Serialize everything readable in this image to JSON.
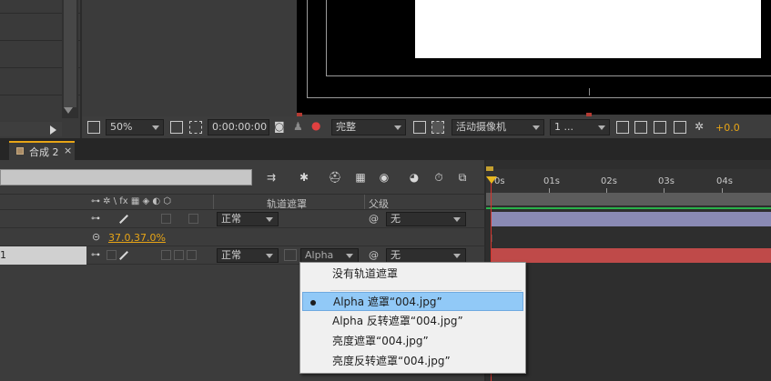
{
  "viewer": {
    "zoom": "50%",
    "timecode": "0:00:00:00",
    "resolution": "完整",
    "camera": "活动摄像机",
    "views": "1 ...",
    "exposure": "+0.0"
  },
  "tab": {
    "label": "合成 2",
    "close": "×"
  },
  "timeline": {
    "columns": {
      "switches": "⊶ ✲ \\ fx ▦ ◈ ◐ ⬡",
      "track_matte": "轨道遮罩",
      "parent": "父级"
    },
    "rows": [
      {
        "mode": "正常",
        "parent": "无"
      },
      {
        "scale": "37.0,37.0%"
      },
      {
        "layer_name_fragment": "1",
        "mode": "正常",
        "track_matte": "Alpha",
        "parent": "无"
      }
    ],
    "ruler": [
      "0s",
      "01s",
      "02s",
      "03s",
      "04s"
    ]
  },
  "menu": {
    "items": [
      "没有轨道遮罩",
      "Alpha 遮罩“004.jpg”",
      "Alpha 反转遮罩“004.jpg”",
      "亮度遮罩“004.jpg”",
      "亮度反转遮罩“004.jpg”"
    ],
    "selected_index": 1
  }
}
